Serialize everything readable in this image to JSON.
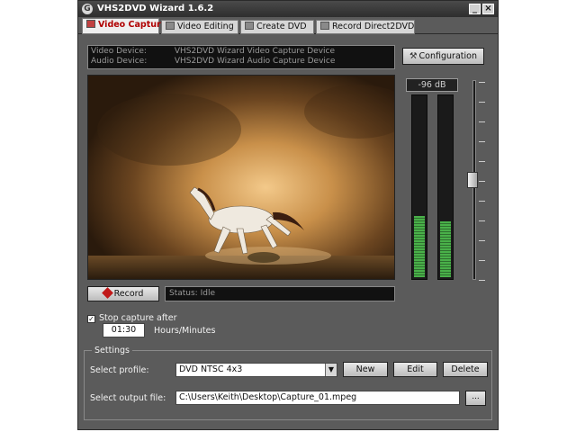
{
  "window": {
    "title": "VHS2DVD Wizard 1.6.2",
    "icon": "app-icon",
    "minimize_label": "_",
    "close_label": "×"
  },
  "tabs": [
    {
      "label": "Video Capture",
      "active": true,
      "icon": "capture-icon"
    },
    {
      "label": "Video Editing",
      "active": false,
      "icon": "film-icon"
    },
    {
      "label": "Create DVD",
      "active": false,
      "icon": "disc-icon"
    },
    {
      "label": "Record Direct2DVD",
      "active": false,
      "icon": "record-disc-icon"
    }
  ],
  "devices": {
    "video_label": "Video Device:",
    "video_value": "VHS2DVD Wizard Video Capture Device",
    "audio_label": "Audio Device:",
    "audio_value": "VHS2DVD Wizard Audio Capture Device"
  },
  "configuration_label": "Configuration",
  "record_label": "Record",
  "status_text": "Status: Idle",
  "audio_meter": {
    "db_readout": "-96 dB",
    "left_level": 0.34,
    "right_level": 0.31,
    "volume_level": 0.5
  },
  "stop_capture": {
    "checked": true,
    "label": "Stop capture after",
    "time_value": "01:30",
    "unit_label": "Hours/Minutes"
  },
  "settings": {
    "legend": "Settings",
    "profile_label": "Select profile:",
    "profile_value": "DVD NTSC 4x3",
    "new_label": "New",
    "edit_label": "Edit",
    "delete_label": "Delete",
    "output_label": "Select output file:",
    "output_value": "C:\\Users\\Keith\\Desktop\\Capture_01.mpeg",
    "browse_label": "..."
  },
  "colors": {
    "window_bg": "#5b5b5b",
    "active_tab_text": "#b00000",
    "meter_green": "#49b049"
  }
}
